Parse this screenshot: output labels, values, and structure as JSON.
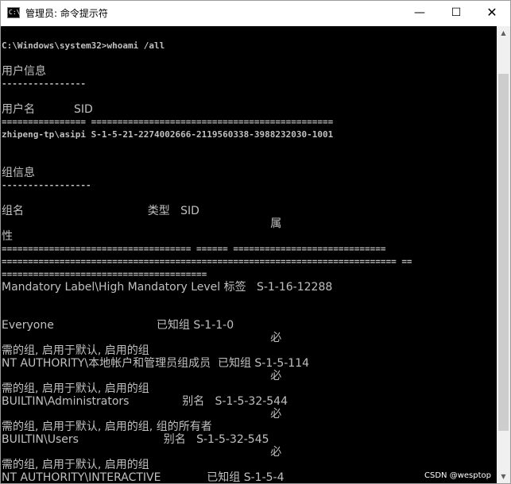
{
  "window": {
    "title": "管理员: 命令提示符",
    "icon_text": "C:\\.",
    "minimize": "—",
    "maximize": "☐",
    "close": "✕"
  },
  "console": {
    "lines": [
      {
        "t": "C:\\Windows\\system32>whoami /all",
        "cjk": false
      },
      {
        "t": "用户信息",
        "cjk": true
      },
      {
        "t": "----------------",
        "cjk": false
      },
      {
        "t": "用户名           SID",
        "cjk": true
      },
      {
        "t": "================ ==============================================",
        "cjk": false
      },
      {
        "t": "zhipeng-tp\\asipi S-1-5-21-2274002666-2119560338-3988232030-1001",
        "cjk": false
      },
      {
        "t": "组信息",
        "cjk": true
      },
      {
        "t": "-----------------",
        "cjk": false
      },
      {
        "t": "组名                                   类型   SID",
        "cjk": true
      },
      {
        "t": "                                                                            属",
        "cjk": true
      },
      {
        "t": "性",
        "cjk": true
      },
      {
        "t": "==================================== ====== =============================",
        "cjk": false
      },
      {
        "t": "=========================================================================== ==",
        "cjk": false
      },
      {
        "t": "=======================================",
        "cjk": false
      },
      {
        "t": "Mandatory Label\\High Mandatory Level 标签   S-1-16-12288",
        "cjk": true
      },
      {
        "t": "Everyone                             已知组 S-1-1-0",
        "cjk": true
      },
      {
        "t": "                                                                            必",
        "cjk": true
      },
      {
        "t": "需的组, 启用于默认, 启用的组",
        "cjk": true
      },
      {
        "t": "NT AUTHORITY\\本地帐户和管理员组成员  已知组 S-1-5-114",
        "cjk": true
      },
      {
        "t": "                                                                            必",
        "cjk": true
      },
      {
        "t": "需的组, 启用于默认, 启用的组",
        "cjk": true
      },
      {
        "t": "BUILTIN\\Administrators               别名   S-1-5-32-544",
        "cjk": true
      },
      {
        "t": "                                                                            必",
        "cjk": true
      },
      {
        "t": "需的组, 启用于默认, 启用的组, 组的所有者",
        "cjk": true
      },
      {
        "t": "BUILTIN\\Users                        别名   S-1-5-32-545",
        "cjk": true
      },
      {
        "t": "                                                                            必",
        "cjk": true
      },
      {
        "t": "需的组, 启用于默认, 启用的组",
        "cjk": true
      },
      {
        "t": "NT AUTHORITY\\INTERACTIVE             已知组 S-1-5-4",
        "cjk": true
      }
    ]
  },
  "watermark": "CSDN @wesptop"
}
